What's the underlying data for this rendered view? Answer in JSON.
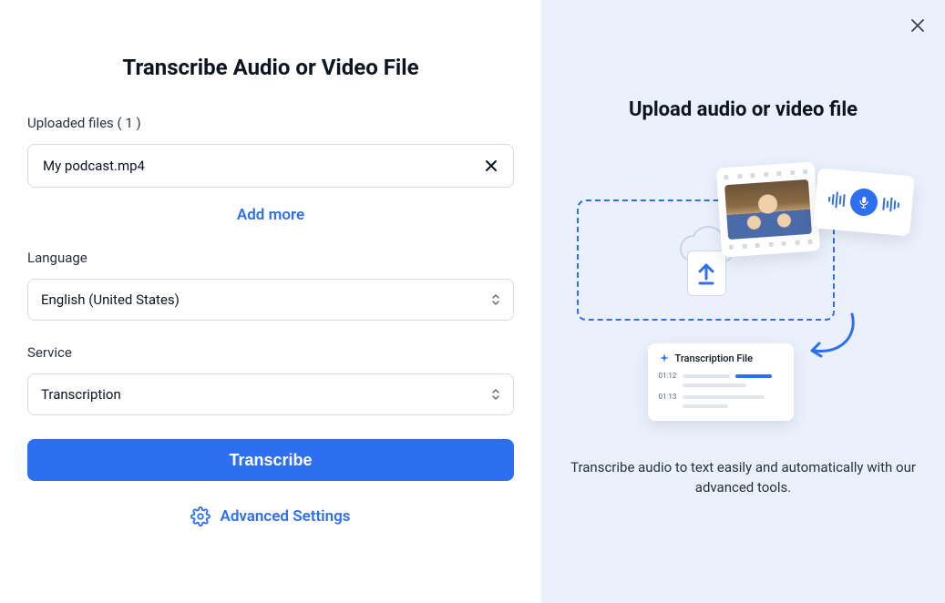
{
  "left": {
    "title": "Transcribe Audio or Video File",
    "uploadedFilesLabel": "Uploaded files ( 1 )",
    "file": "My podcast.mp4",
    "addMore": "Add more",
    "languageLabel": "Language",
    "languageValue": "English (United States)",
    "serviceLabel": "Service",
    "serviceValue": "Transcription",
    "transcribeBtn": "Transcribe",
    "advanced": "Advanced Settings"
  },
  "right": {
    "title": "Upload audio or video file",
    "transFileLabel": "Transcription File",
    "time1": "01:12",
    "time2": "01:13",
    "desc": "Transcribe audio to text easily and automatically with our advanced tools."
  }
}
